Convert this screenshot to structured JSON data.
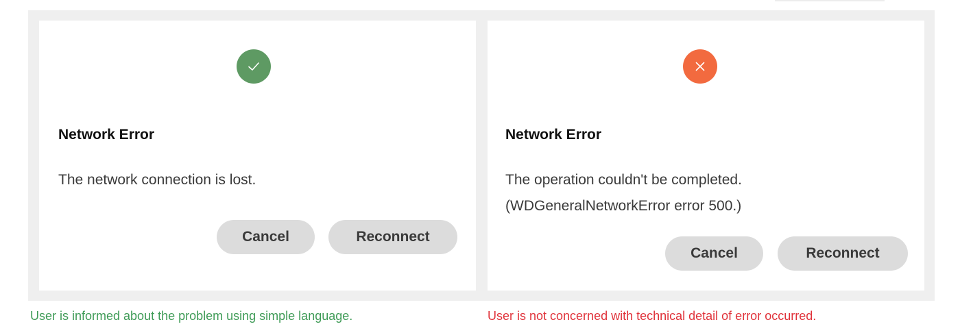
{
  "colors": {
    "success": "#5e9a63",
    "error": "#f26a3f",
    "good_caption": "#3f9b57",
    "bad_caption": "#e0323a"
  },
  "examples": [
    {
      "icon": "check-icon",
      "dialog": {
        "title": "Network Error",
        "message": "The network connection is lost.",
        "cancel_label": "Cancel",
        "reconnect_label": "Reconnect"
      },
      "caption": "User is informed about the problem using simple language."
    },
    {
      "icon": "close-icon",
      "dialog": {
        "title": "Network Error",
        "message": "The operation couldn't be completed.\n(WDGeneralNetworkError error 500.)",
        "cancel_label": "Cancel",
        "reconnect_label": "Reconnect"
      },
      "caption": "User is not concerned with technical detail of error occurred."
    }
  ]
}
